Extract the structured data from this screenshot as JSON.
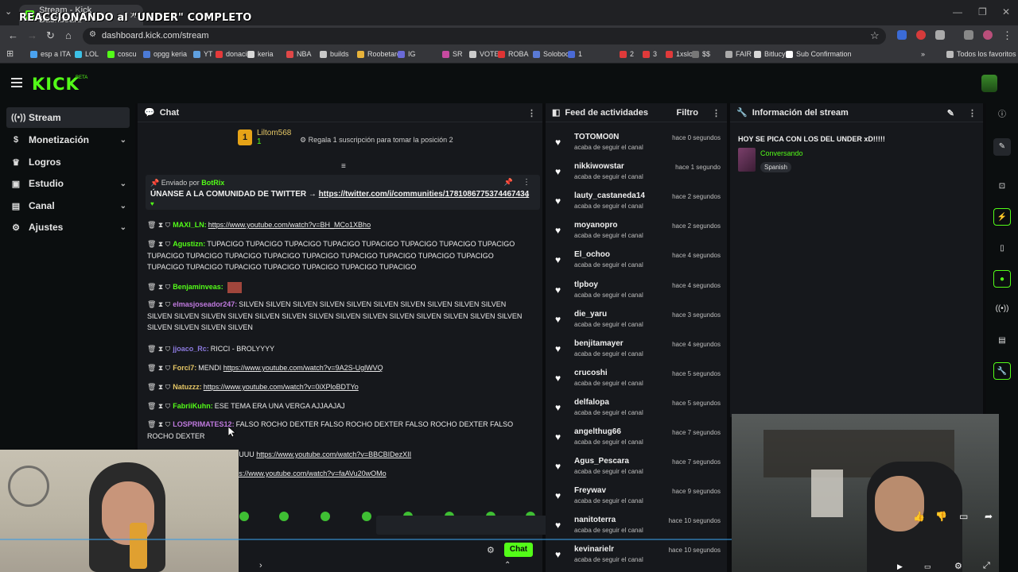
{
  "browser": {
    "tab_title": "Stream - Kick Dashboard",
    "overlay_title": "REACCIONANDO al \"UNDER\" COMPLETO",
    "url": "dashboard.kick.com/stream",
    "bookmarks": [
      "esp a ITA",
      "LOL",
      "coscu",
      "opgg keria",
      "YT",
      "donacion",
      "keria",
      "NBA",
      "builds",
      "Roobetardo",
      "IG",
      "SR",
      "VOTE",
      "ROBA",
      "Soloboom",
      "1",
      "2",
      "3",
      "1xslot",
      "$$",
      "FAIR",
      "Bitlucy",
      "Sub Confirmation"
    ],
    "bookmarks_all": "Todos los favoritos"
  },
  "kick": {
    "logo": "KICK",
    "logo_sup": "BETA"
  },
  "sidebar": {
    "items": [
      {
        "label": "Stream",
        "icon": "broadcast-icon"
      },
      {
        "label": "Monetización",
        "icon": "dollar-icon"
      },
      {
        "label": "Logros",
        "icon": "trophy-icon"
      },
      {
        "label": "Estudio",
        "icon": "studio-icon"
      },
      {
        "label": "Canal",
        "icon": "channel-icon"
      },
      {
        "label": "Ajustes",
        "icon": "gear-icon"
      }
    ]
  },
  "chat": {
    "title": "Chat",
    "pinned_user": {
      "rank": "1",
      "name": "Liltom568",
      "count": "1"
    },
    "pinned_sub": "Regala 1 suscripción para tomar la posición 2",
    "pinned_message": {
      "by": "Enviado por",
      "bot": "BotRix",
      "text": "ÚNANSE A LA COMUNIDAD DE TWITTER →",
      "link": "https://twitter.com/i/communities/1781086775374467434"
    },
    "messages": [
      {
        "user": "MAXI_LN:",
        "color": "#53fc18",
        "text": "",
        "link": "https://www.youtube.com/watch?v=BH_MCo1XBho"
      },
      {
        "user": "Agustizn:",
        "color": "#53fc18",
        "text": "TUPACIGO TUPACIGO TUPACIGO TUPACIGO TUPACIGO TUPACIGO TUPACIGO TUPACIGO TUPACIGO TUPACIGO TUPACIGO TUPACIGO TUPACIGO TUPACIGO TUPACIGO TUPACIGO TUPACIGO TUPACIGO TUPACIGO TUPACIGO TUPACIGO TUPACIGO TUPACIGO TUPACIGO",
        "link": ""
      },
      {
        "user": "Benjaminveas:",
        "color": "#53fc18",
        "text": "",
        "link": ""
      },
      {
        "user": "elmasjoseador247:",
        "color": "#c07adf",
        "text": "SILVEN SILVEN SILVEN SILVEN SILVEN SILVEN SILVEN SILVEN SILVEN SILVEN SILVEN SILVEN SILVEN SILVEN SILVEN SILVEN SILVEN SILVEN SILVEN SILVEN SILVEN SILVEN SILVEN SILVEN SILVEN SILVEN SILVEN SILVEN",
        "link": ""
      },
      {
        "user": "jjoaco_Rc:",
        "color": "#8c7adf",
        "text": "RICCI - BROLYYYY",
        "link": ""
      },
      {
        "user": "Forci7:",
        "color": "#e6c766",
        "text": "MENDI",
        "link": "https://www.youtube.com/watch?v=9A2S-UglWVQ"
      },
      {
        "user": "Natuzzz:",
        "color": "#e6c766",
        "text": "",
        "link": "https://www.youtube.com/watch?v=0iXPloBDTYo"
      },
      {
        "user": "FabriiKuhn:",
        "color": "#53fc18",
        "text": "ESE TEMA ERA UNA VERGA AJJAAJAJ",
        "link": ""
      },
      {
        "user": "LOSPRIMATES12:",
        "color": "#c07adf",
        "text": "FALSO ROCHO DEXTER FALSO ROCHO DEXTER FALSO ROCHO DEXTER FALSO ROCHO DEXTER",
        "link": ""
      },
      {
        "user": "",
        "color": "#eaeaea",
        "text": "ESTEEEE COSCUUUUU",
        "link": "https://www.youtube.com/watch?v=BBCBIDezXII"
      },
      {
        "user": "",
        "color": "#eaeaea",
        "text": "ROASTERISCO",
        "link": "https://www.youtube.com/watch?v=faAVu20wOMo"
      }
    ],
    "send_label": "Chat"
  },
  "feed": {
    "title": "Feed de actividades",
    "filter": "Filtro",
    "items": [
      {
        "user": "TOTOMO0N",
        "action": "acaba de seguir el canal",
        "time": "hace 0 segundos"
      },
      {
        "user": "nikkiwowstar",
        "action": "acaba de seguir el canal",
        "time": "hace 1 segundo"
      },
      {
        "user": "lauty_castaneda14",
        "action": "acaba de seguir el canal",
        "time": "hace 2 segundos"
      },
      {
        "user": "moyanopro",
        "action": "acaba de seguir el canal",
        "time": "hace 2 segundos"
      },
      {
        "user": "El_ochoo",
        "action": "acaba de seguir el canal",
        "time": "hace 4 segundos"
      },
      {
        "user": "tlpboy",
        "action": "acaba de seguir el canal",
        "time": "hace 4 segundos"
      },
      {
        "user": "die_yaru",
        "action": "acaba de seguir el canal",
        "time": "hace 3 segundos"
      },
      {
        "user": "benjitamayer",
        "action": "acaba de seguir el canal",
        "time": "hace 4 segundos"
      },
      {
        "user": "crucoshi",
        "action": "acaba de seguir el canal",
        "time": "hace 5 segundos"
      },
      {
        "user": "delfalopa",
        "action": "acaba de seguir el canal",
        "time": "hace 5 segundos"
      },
      {
        "user": "angelthug66",
        "action": "acaba de seguir el canal",
        "time": "hace 7 segundos"
      },
      {
        "user": "Agus_Pescara",
        "action": "acaba de seguir el canal",
        "time": "hace 7 segundos"
      },
      {
        "user": "Freywav",
        "action": "acaba de seguir el canal",
        "time": "hace 9 segundos"
      },
      {
        "user": "nanitoterra",
        "action": "acaba de seguir el canal",
        "time": "hace 10 segundos"
      },
      {
        "user": "kevinarielr",
        "action": "acaba de seguir el canal",
        "time": "hace 10 segundos"
      }
    ]
  },
  "stream_info": {
    "title": "Información del stream",
    "stream_title": "HOY SE PICA CON LOS DEL UNDER xD!!!!!",
    "category": "Conversando",
    "tag": "Spanish"
  },
  "colors": {
    "accent": "#53fc18",
    "panel": "#16181c",
    "bg": "#0b0e0f"
  }
}
